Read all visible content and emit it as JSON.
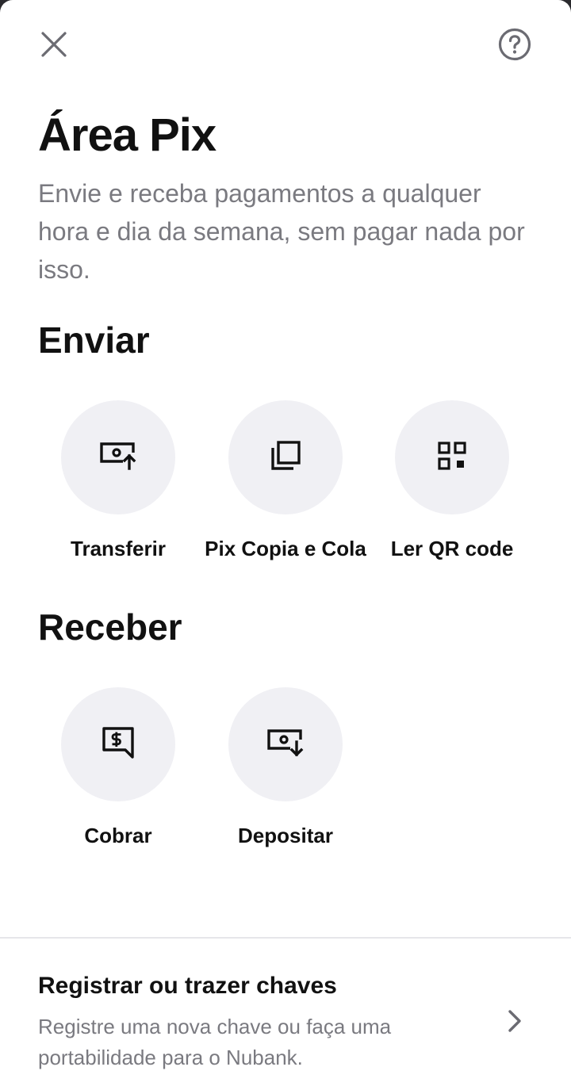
{
  "header": {
    "close_icon": "close-icon",
    "help_icon": "question-circle-icon"
  },
  "title": "Área Pix",
  "subtitle": "Envie e receba pagamentos a qualquer hora e dia da semana, sem pagar nada por isso.",
  "sections": {
    "enviar": {
      "title": "Enviar",
      "actions": [
        {
          "label": "Transferir",
          "icon": "money-send-icon"
        },
        {
          "label": "Pix Copia e Cola",
          "icon": "copy-icon"
        },
        {
          "label": "Ler QR code",
          "icon": "qr-code-icon"
        }
      ]
    },
    "receber": {
      "title": "Receber",
      "actions": [
        {
          "label": "Cobrar",
          "icon": "charge-icon"
        },
        {
          "label": "Depositar",
          "icon": "money-receive-icon"
        }
      ]
    }
  },
  "keys": {
    "title": "Registrar ou trazer chaves",
    "description": "Registre uma nova chave ou faça uma portabilidade para o Nubank.",
    "chevron_icon": "chevron-right-icon"
  },
  "colors": {
    "background": "#ffffff",
    "circle": "#f0f0f4",
    "text_primary": "#111111",
    "text_secondary": "#7a7a80",
    "divider": "#e6e6ea"
  }
}
